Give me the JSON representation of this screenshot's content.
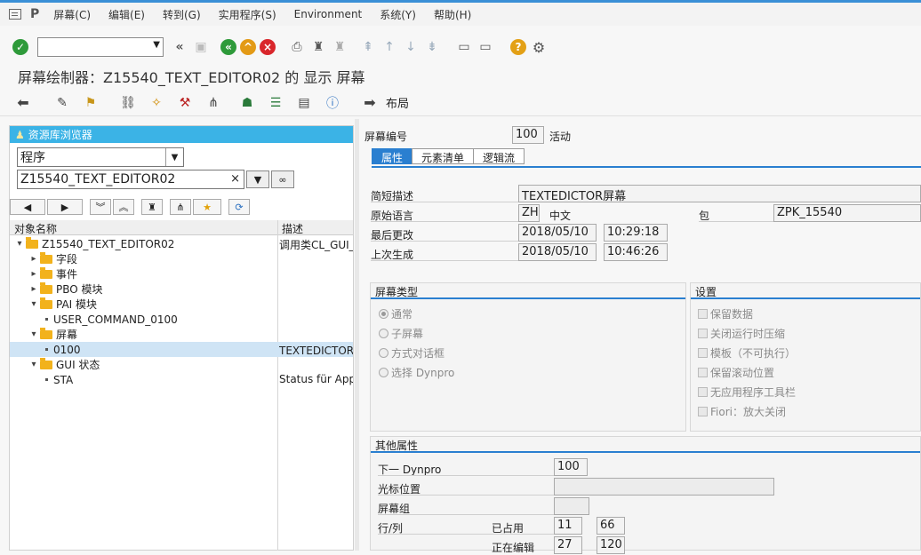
{
  "menu": {
    "items": [
      "屏幕(C)",
      "编辑(E)",
      "转到(G)",
      "实用程序(S)",
      "Environment",
      "系统(Y)",
      "帮助(H)"
    ]
  },
  "toolbar": {
    "command_value": "",
    "icons": [
      "enter-icon",
      "back-icon",
      "save-icon",
      "exit-icon",
      "up-icon",
      "cancel-icon",
      "print-icon",
      "find-icon",
      "find-next-icon",
      "first-page-icon",
      "prev-page-icon",
      "next-page-icon",
      "last-page-icon",
      "new-session-icon",
      "shortcut-icon",
      "help-icon",
      "settings-icon"
    ]
  },
  "page_title": "屏幕绘制器：Z15540_TEXT_EDITOR02 的 显示 屏幕",
  "app_toolbar": {
    "layout_label": "布局"
  },
  "repository": {
    "header": "资源库浏览器",
    "object_type": "程序",
    "object_name": "Z15540_TEXT_EDITOR02",
    "col_name": "对象名称",
    "col_desc": "描述",
    "tree": [
      {
        "level": 0,
        "expand": "open",
        "type": "folder",
        "label": "Z15540_TEXT_EDITOR02",
        "desc": "调用类CL_GUI_"
      },
      {
        "level": 1,
        "expand": "closed",
        "type": "folder",
        "label": "字段",
        "desc": ""
      },
      {
        "level": 1,
        "expand": "closed",
        "type": "folder",
        "label": "事件",
        "desc": ""
      },
      {
        "level": 1,
        "expand": "closed",
        "type": "folder",
        "label": "PBO 模块",
        "desc": ""
      },
      {
        "level": 1,
        "expand": "open",
        "type": "folder",
        "label": "PAI 模块",
        "desc": ""
      },
      {
        "level": 2,
        "expand": "none",
        "type": "leaf",
        "label": "USER_COMMAND_0100",
        "desc": ""
      },
      {
        "level": 1,
        "expand": "open",
        "type": "folder",
        "label": "屏幕",
        "desc": ""
      },
      {
        "level": 2,
        "expand": "none",
        "type": "leaf",
        "label": "0100",
        "desc": "TEXTEDICTOR屏",
        "selected": true
      },
      {
        "level": 1,
        "expand": "open",
        "type": "folder",
        "label": "GUI 状态",
        "desc": ""
      },
      {
        "level": 2,
        "expand": "none",
        "type": "leaf",
        "label": "STA",
        "desc": "Status für Appe"
      }
    ]
  },
  "screen": {
    "number_label": "屏幕编号",
    "number": "100",
    "status": "活动",
    "tabs": [
      "属性",
      "元素清单",
      "逻辑流"
    ],
    "short_desc_label": "简短描述",
    "short_desc": "TEXTEDICTOR屏幕",
    "orig_lang_label": "原始语言",
    "orig_lang_code": "ZH",
    "orig_lang_name": "中文",
    "package_label": "包",
    "package": "ZPK_15540",
    "last_changed_label": "最后更改",
    "last_changed_date": "2018/05/10",
    "last_changed_time": "10:29:18",
    "last_gen_label": "上次生成",
    "last_gen_date": "2018/05/10",
    "last_gen_time": "10:46:26"
  },
  "screen_type": {
    "title": "屏幕类型",
    "options": [
      "通常",
      "子屏幕",
      "方式对话框",
      "选择 Dynpro"
    ],
    "selected_index": 0
  },
  "settings": {
    "title": "设置",
    "options": [
      "保留数据",
      "关闭运行时压缩",
      "模板（不可执行）",
      "保留滚动位置",
      "无应用程序工具栏",
      "Fiori：放大关闭"
    ]
  },
  "other": {
    "title": "其他属性",
    "next_dynpro_label": "下一 Dynpro",
    "next_dynpro": "100",
    "cursor_label": "光标位置",
    "cursor": "",
    "group_label": "屏幕组",
    "group": "",
    "rowcol_label": "行/列",
    "used_label": "已占用",
    "used_row": "11",
    "used_col": "66",
    "edit_label": "正在编辑",
    "edit_row": "27",
    "edit_col": "120"
  }
}
